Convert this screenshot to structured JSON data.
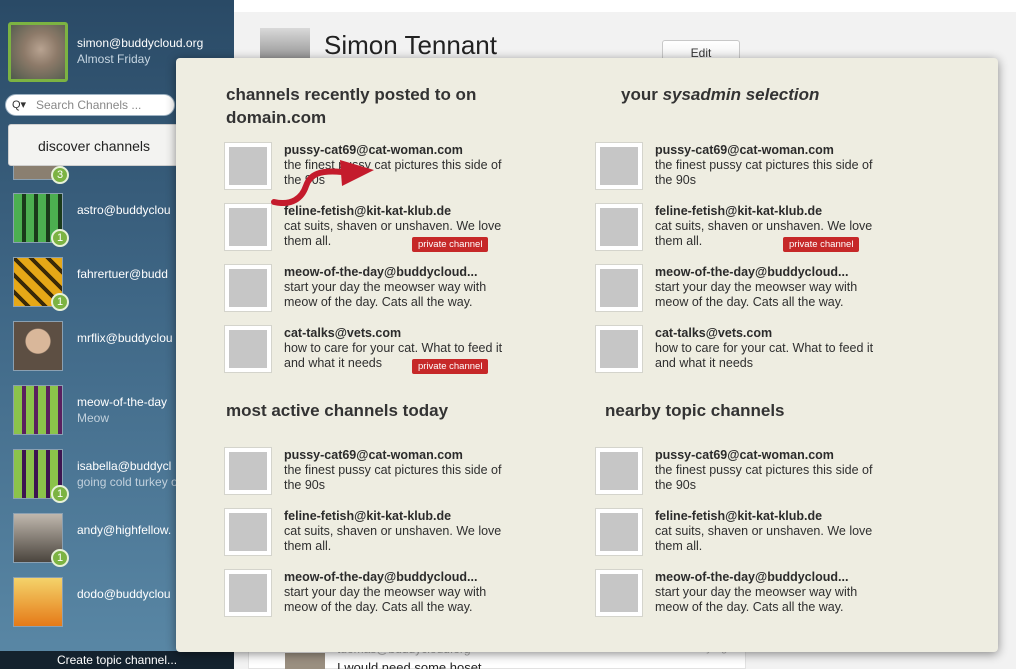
{
  "sidebar": {
    "me": {
      "name": "simon@buddycloud.org",
      "status": "Almost Friday"
    },
    "search": {
      "placeholder": "Search Channels ..."
    },
    "discover_label": "discover channels",
    "channels": [
      {
        "name": "",
        "sub": "",
        "badge": "3",
        "color": "#8a7f70"
      },
      {
        "name": "astro@buddyclou",
        "sub": "",
        "badge": "1",
        "color": "#2a4d2a"
      },
      {
        "name": "fahrertuer@budd",
        "sub": "",
        "badge": "1",
        "color": "#c98a10"
      },
      {
        "name": "mrflix@buddyclou",
        "sub": "",
        "badge": "",
        "color": "#8d7d6b"
      },
      {
        "name": "meow-of-the-day",
        "sub": "Meow",
        "badge": "",
        "color": "#6b2a6f"
      },
      {
        "name": "isabella@buddycl",
        "sub": "going cold turkey o",
        "badge": "1",
        "color": "#4a1f5a"
      },
      {
        "name": "andy@highfellow.",
        "sub": "",
        "badge": "1",
        "color": "#6a6258"
      },
      {
        "name": "dodo@buddyclou",
        "sub": "",
        "badge": "",
        "color": "#e69a2a"
      }
    ],
    "create_label": "Create topic channel..."
  },
  "profile": {
    "name": "Simon Tennant",
    "edit_label": "Edit",
    "post_author": "tuomas@buddycloud.org",
    "post_time": "a day ago",
    "post_text": "I would need some hoset"
  },
  "popup": {
    "sections": [
      {
        "title_plain": "channels recently posted to on domain.com",
        "items": [
          {
            "name": "pussy-cat69@cat-woman.com",
            "desc": "the finest pussy cat pictures this side of the 90s",
            "private": ""
          },
          {
            "name": "feline-fetish@kit-kat-klub.de",
            "desc": "cat suits, shaven or unshaven. We love them all.",
            "private": "private channel"
          },
          {
            "name": "meow-of-the-day@buddycloud...",
            "desc": "start your day the meowser way with meow of the day. Cats all the way.",
            "private": ""
          },
          {
            "name": "cat-talks@vets.com",
            "desc": "how to care for your cat. What to feed it and what it needs",
            "private": "private channel"
          }
        ]
      },
      {
        "title_prefix": "your ",
        "title_em": "sysadmin selection",
        "items": [
          {
            "name": "pussy-cat69@cat-woman.com",
            "desc": "the finest pussy cat pictures this side of the 90s",
            "private": ""
          },
          {
            "name": "feline-fetish@kit-kat-klub.de",
            "desc": "cat suits, shaven or unshaven. We love them all.",
            "private": "private channel"
          },
          {
            "name": "meow-of-the-day@buddycloud...",
            "desc": "start your day the meowser way with meow of the day. Cats all the way.",
            "private": ""
          },
          {
            "name": "cat-talks@vets.com",
            "desc": "how to care for your cat. What to feed it and what it needs",
            "private": ""
          }
        ]
      },
      {
        "title_plain": "most active channels today",
        "items": [
          {
            "name": "pussy-cat69@cat-woman.com",
            "desc": "the finest pussy cat pictures this side of the 90s",
            "private": ""
          },
          {
            "name": "feline-fetish@kit-kat-klub.de",
            "desc": "cat suits, shaven or unshaven. We love them all.",
            "private": ""
          },
          {
            "name": "meow-of-the-day@buddycloud...",
            "desc": "start your day the meowser way with meow of the day. Cats all the way.",
            "private": ""
          }
        ]
      },
      {
        "title_plain": "nearby topic channels",
        "items": [
          {
            "name": "pussy-cat69@cat-woman.com",
            "desc": "the finest pussy cat pictures this side of the 90s",
            "private": ""
          },
          {
            "name": "feline-fetish@kit-kat-klub.de",
            "desc": "cat suits, shaven or unshaven. We love them all.",
            "private": ""
          },
          {
            "name": "meow-of-the-day@buddycloud...",
            "desc": "start your day the meowser way with meow of the day. Cats all the way.",
            "private": ""
          }
        ]
      }
    ]
  },
  "colors": {
    "accent_green": "#7cb342",
    "private_red": "#c62828",
    "popup_bg": "#eeede1"
  }
}
